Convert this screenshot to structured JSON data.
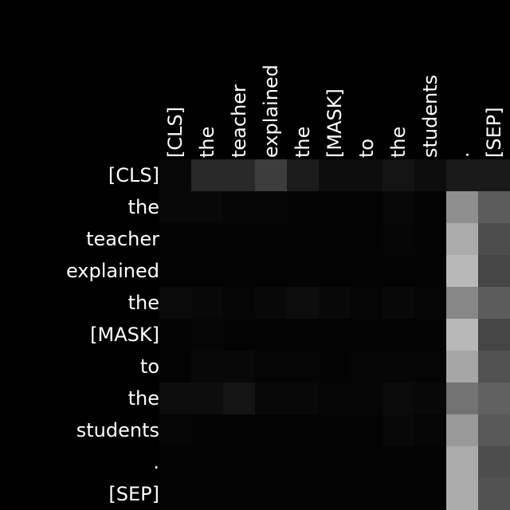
{
  "chart_data": {
    "type": "heatmap",
    "colormap": "grayscale",
    "background": "#000000",
    "x_tokens": [
      "[CLS]",
      "the",
      "teacher",
      "explained",
      "the",
      "[MASK]",
      "to",
      "the",
      "students",
      ".",
      "[SEP]"
    ],
    "y_tokens": [
      "[CLS]",
      "the",
      "teacher",
      "explained",
      "the",
      "[MASK]",
      "to",
      "the",
      "students",
      ".",
      "[SEP]"
    ],
    "values": [
      [
        0.03,
        0.16,
        0.16,
        0.24,
        0.11,
        0.05,
        0.05,
        0.08,
        0.05,
        0.1,
        0.1
      ],
      [
        0.03,
        0.03,
        0.02,
        0.02,
        0.01,
        0.01,
        0.01,
        0.03,
        0.01,
        0.56,
        0.36
      ],
      [
        0.01,
        0.01,
        0.01,
        0.01,
        0.01,
        0.01,
        0.01,
        0.02,
        0.01,
        0.67,
        0.3
      ],
      [
        0.01,
        0.01,
        0.01,
        0.01,
        0.01,
        0.01,
        0.01,
        0.01,
        0.01,
        0.72,
        0.27
      ],
      [
        0.04,
        0.03,
        0.02,
        0.03,
        0.05,
        0.03,
        0.02,
        0.03,
        0.02,
        0.53,
        0.36
      ],
      [
        0.01,
        0.02,
        0.01,
        0.01,
        0.01,
        0.01,
        0.01,
        0.01,
        0.01,
        0.72,
        0.27
      ],
      [
        0.01,
        0.03,
        0.03,
        0.02,
        0.02,
        0.01,
        0.02,
        0.02,
        0.02,
        0.65,
        0.32
      ],
      [
        0.05,
        0.05,
        0.08,
        0.03,
        0.03,
        0.02,
        0.02,
        0.04,
        0.03,
        0.45,
        0.38
      ],
      [
        0.02,
        0.01,
        0.01,
        0.01,
        0.01,
        0.01,
        0.01,
        0.03,
        0.02,
        0.6,
        0.35
      ],
      [
        0.01,
        0.01,
        0.01,
        0.01,
        0.01,
        0.01,
        0.01,
        0.01,
        0.01,
        0.67,
        0.3
      ],
      [
        0.01,
        0.01,
        0.01,
        0.01,
        0.01,
        0.01,
        0.01,
        0.01,
        0.01,
        0.67,
        0.32
      ]
    ],
    "value_range": [
      0,
      1
    ],
    "title": "",
    "xlabel": "",
    "ylabel": "",
    "x_ticks_position": "top",
    "grid": false,
    "legend": "none"
  }
}
